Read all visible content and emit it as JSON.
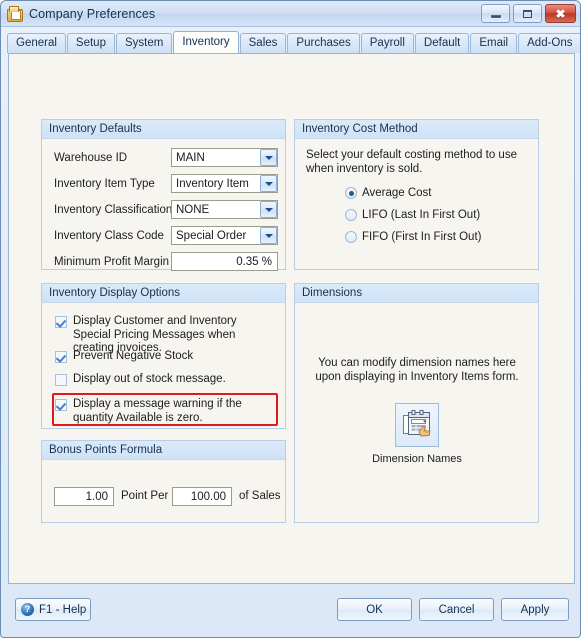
{
  "window": {
    "title": "Company Preferences",
    "icon": "folder-document-icon",
    "controls": {
      "minimize": "Minimize",
      "maximize": "Maximize",
      "close": "Close"
    }
  },
  "tabs": [
    {
      "label": "General",
      "active": false
    },
    {
      "label": "Setup",
      "active": false
    },
    {
      "label": "System",
      "active": false
    },
    {
      "label": "Inventory",
      "active": true
    },
    {
      "label": "Sales",
      "active": false
    },
    {
      "label": "Purchases",
      "active": false
    },
    {
      "label": "Payroll",
      "active": false
    },
    {
      "label": "Default",
      "active": false
    },
    {
      "label": "Email",
      "active": false
    },
    {
      "label": "Add-Ons",
      "active": false
    }
  ],
  "inventory_defaults": {
    "title": "Inventory Defaults",
    "rows": [
      {
        "label": "Warehouse ID",
        "value": "MAIN"
      },
      {
        "label": "Inventory Item Type",
        "value": "Inventory Item"
      },
      {
        "label": "Inventory Classification",
        "value": "NONE"
      },
      {
        "label": "Inventory Class Code",
        "value": "Special Order"
      }
    ],
    "margin_label": "Minimum Profit Margin",
    "margin_value": "0.35 %"
  },
  "cost_method": {
    "title": "Inventory Cost Method",
    "description": "Select your default costing method to use when inventory is sold.",
    "options": [
      {
        "label": "Average Cost",
        "selected": true
      },
      {
        "label": "LIFO (Last In First Out)",
        "selected": false
      },
      {
        "label": "FIFO (First In First Out)",
        "selected": false
      }
    ]
  },
  "display_options": {
    "title": "Inventory Display Options",
    "items": [
      {
        "label": "Display Customer and Inventory Special Pricing Messages when creating invoices.",
        "checked": true,
        "highlighted": false
      },
      {
        "label": "Prevent Negative Stock",
        "checked": true,
        "highlighted": false
      },
      {
        "label": "Display out of stock message.",
        "checked": false,
        "highlighted": false
      },
      {
        "label": "Display a message warning if the quantity Available is zero.",
        "checked": true,
        "highlighted": true
      }
    ],
    "highlight_color": "#e01b1b"
  },
  "dimensions": {
    "title": "Dimensions",
    "description": "You can modify dimension names here upon displaying in Inventory Items form.",
    "button_icon": "dimension-names-form-icon",
    "button_caption": "Dimension Names"
  },
  "bonus_points": {
    "title": "Bonus Points Formula",
    "points_value": "1.00",
    "middle_label": "Point Per",
    "amount_value": "100.00",
    "trailing_label": "of Sales"
  },
  "footer": {
    "help_label": "F1 - Help",
    "help_icon": "question-circle-icon",
    "ok_label": "OK",
    "cancel_label": "Cancel",
    "apply_label": "Apply"
  }
}
